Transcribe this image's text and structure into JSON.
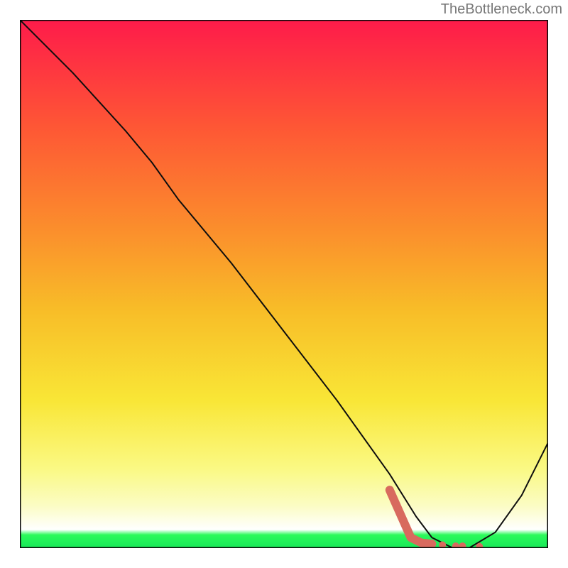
{
  "attribution": "TheBottleneck.com",
  "chart_data": {
    "type": "line",
    "title": "",
    "xlabel": "",
    "ylabel": "",
    "xlim": [
      0,
      100
    ],
    "ylim": [
      0,
      100
    ],
    "grid": false,
    "series": [
      {
        "name": "curve",
        "color": "#0e0e0e",
        "width": 2,
        "x": [
          0,
          10,
          20,
          25,
          30,
          40,
          50,
          60,
          70,
          75,
          78,
          82,
          85,
          90,
          95,
          100
        ],
        "y": [
          100,
          90,
          79,
          73,
          66,
          54,
          41,
          28,
          14,
          6,
          2,
          0,
          0,
          3,
          10,
          20
        ]
      },
      {
        "name": "highlight",
        "color": "#d86a5e",
        "width": 12,
        "linecap": "round",
        "x": [
          70,
          74,
          76,
          78
        ],
        "y": [
          11,
          2,
          1,
          0.8
        ]
      }
    ],
    "points": [
      {
        "name": "dash-dot-1",
        "x": 80,
        "y": 0.6,
        "r": 5,
        "color": "#d86a5e"
      },
      {
        "name": "dash-seg-2",
        "x": 82.5,
        "y": 0.4,
        "r": 5,
        "color": "#d86a5e"
      },
      {
        "name": "dash-seg-2b",
        "x": 83.8,
        "y": 0.4,
        "r": 5,
        "color": "#d86a5e"
      },
      {
        "name": "dash-dot-3",
        "x": 87,
        "y": 0.3,
        "r": 5,
        "color": "#d86a5e"
      }
    ],
    "background_gradient": {
      "stops": [
        {
          "offset": 0.0,
          "color": "#fe1b4a"
        },
        {
          "offset": 0.2,
          "color": "#fe5635"
        },
        {
          "offset": 0.4,
          "color": "#fb8f2c"
        },
        {
          "offset": 0.55,
          "color": "#f8bd28"
        },
        {
          "offset": 0.72,
          "color": "#f9e636"
        },
        {
          "offset": 0.85,
          "color": "#faf984"
        },
        {
          "offset": 0.92,
          "color": "#fbfcc4"
        },
        {
          "offset": 0.965,
          "color": "#ffffff"
        },
        {
          "offset": 0.975,
          "color": "#2bfa5a"
        },
        {
          "offset": 1.0,
          "color": "#17e858"
        }
      ]
    },
    "frame_color": "#060606"
  }
}
